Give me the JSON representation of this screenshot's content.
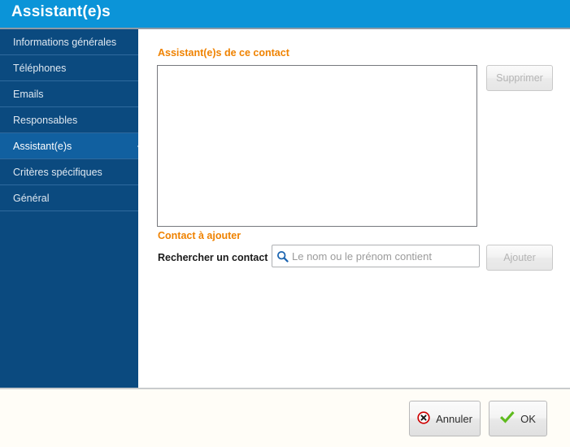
{
  "window": {
    "title": "Assistant(e)s"
  },
  "sidebar": {
    "items": [
      {
        "label": "Informations générales",
        "active": false
      },
      {
        "label": "Téléphones",
        "active": false
      },
      {
        "label": "Emails",
        "active": false
      },
      {
        "label": "Responsables",
        "active": false
      },
      {
        "label": "Assistant(e)s",
        "active": true
      },
      {
        "label": "Critères spécifiques",
        "active": false
      },
      {
        "label": "Général",
        "active": false
      }
    ]
  },
  "main": {
    "assistants_section": {
      "title": "Assistant(e)s de ce contact",
      "list_items": [],
      "delete_button": {
        "label": "Supprimer",
        "disabled": true
      }
    },
    "add_contact_section": {
      "title": "Contact à ajouter",
      "search_label": "Rechercher un contact :",
      "search_icon": "search-icon",
      "search_value": "",
      "search_placeholder": "Le nom ou le prénom contient",
      "add_button": {
        "label": "Ajouter",
        "disabled": true
      }
    }
  },
  "footer": {
    "cancel_button": {
      "label": "Annuler",
      "icon": "cancel-circle-icon"
    },
    "ok_button": {
      "label": "OK",
      "icon": "checkmark-icon"
    }
  },
  "colors": {
    "titlebar": "#0b94d8",
    "sidebar": "#0b4a7f",
    "sidebar_active": "#1160a0",
    "section_title": "#ef8200",
    "search_icon": "#1b64b0",
    "cancel_icon": "#cc0000",
    "ok_icon": "#5fbb1e",
    "footer_bg": "#fffdf7"
  }
}
